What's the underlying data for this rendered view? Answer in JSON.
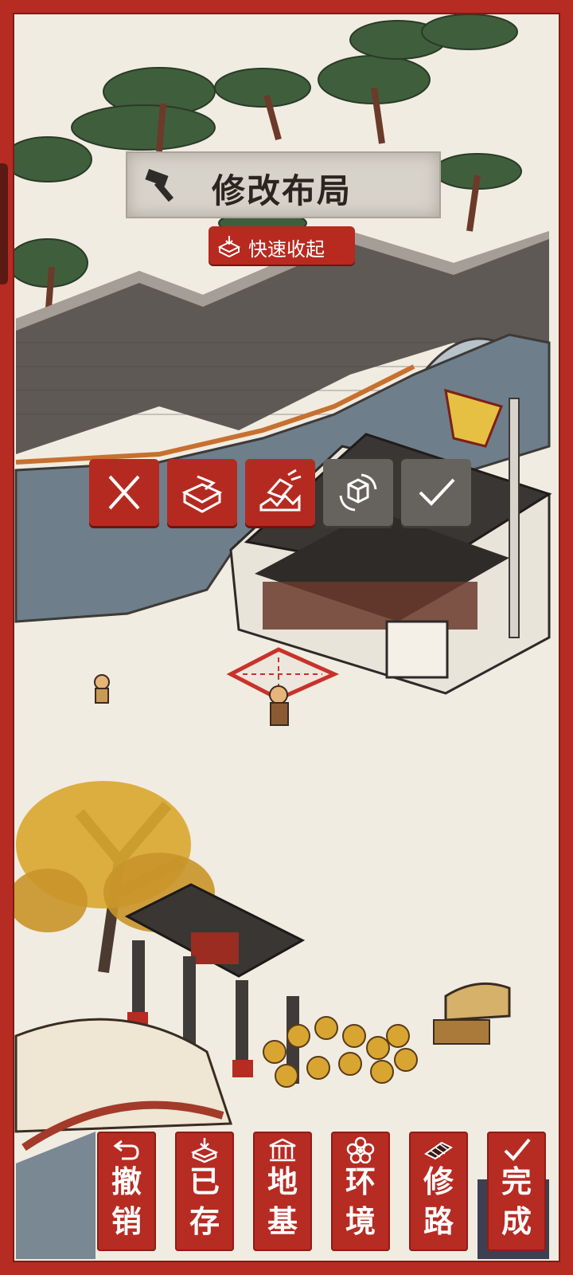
{
  "header": {
    "title": "修改布局",
    "quick_collapse_label": "快速收起"
  },
  "edit_toolbar": {
    "buttons": [
      {
        "icon": "close-icon",
        "label": "cancel"
      },
      {
        "icon": "store-box-icon",
        "label": "store"
      },
      {
        "icon": "demolish-icon",
        "label": "demolish"
      },
      {
        "icon": "rotate-icon",
        "label": "rotate"
      },
      {
        "icon": "check-icon",
        "label": "confirm"
      }
    ]
  },
  "bottom_menu": {
    "undo": {
      "c1": "撤",
      "c2": "销",
      "icon": "undo-icon"
    },
    "stored": {
      "c1": "已",
      "c2": "存",
      "icon": "stored-box-icon"
    },
    "foundation": {
      "c1": "地",
      "c2": "基",
      "icon": "foundation-icon"
    },
    "environment": {
      "c1": "环",
      "c2": "境",
      "icon": "flower-icon"
    },
    "road": {
      "c1": "修",
      "c2": "路",
      "icon": "road-tile-icon"
    },
    "done": {
      "c1": "完",
      "c2": "成",
      "icon": "check-icon"
    }
  },
  "colors": {
    "frame_red": "#b62b22",
    "button_grey": "#66625d",
    "river": "#6f7f8c",
    "wall": "#6a6460",
    "ground": "#f1ece1"
  }
}
